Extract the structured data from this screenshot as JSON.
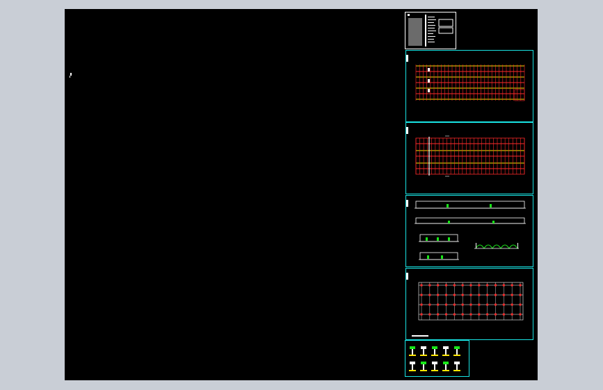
{
  "app": {
    "window": "cad-drawing-preview",
    "background_color": "#c9ced6",
    "viewport_color": "#000000"
  },
  "colors": {
    "sheet_border": "#19e6e6",
    "title_border": "#ffffff",
    "red_lines": "#ff2a2a",
    "yellow_lines": "#ffe600",
    "green_lines": "#19e619",
    "white_lines": "#ffffff",
    "gray_block": "#6b6b6b"
  },
  "sheets": [
    {
      "id": "title-sheet",
      "kind": "cover"
    },
    {
      "id": "foundation-plan",
      "kind": "plan"
    },
    {
      "id": "roof-plan",
      "kind": "plan"
    },
    {
      "id": "elevations",
      "kind": "elevation"
    },
    {
      "id": "column-grid-plan",
      "kind": "plan"
    },
    {
      "id": "detail-sheet",
      "kind": "details"
    }
  ]
}
